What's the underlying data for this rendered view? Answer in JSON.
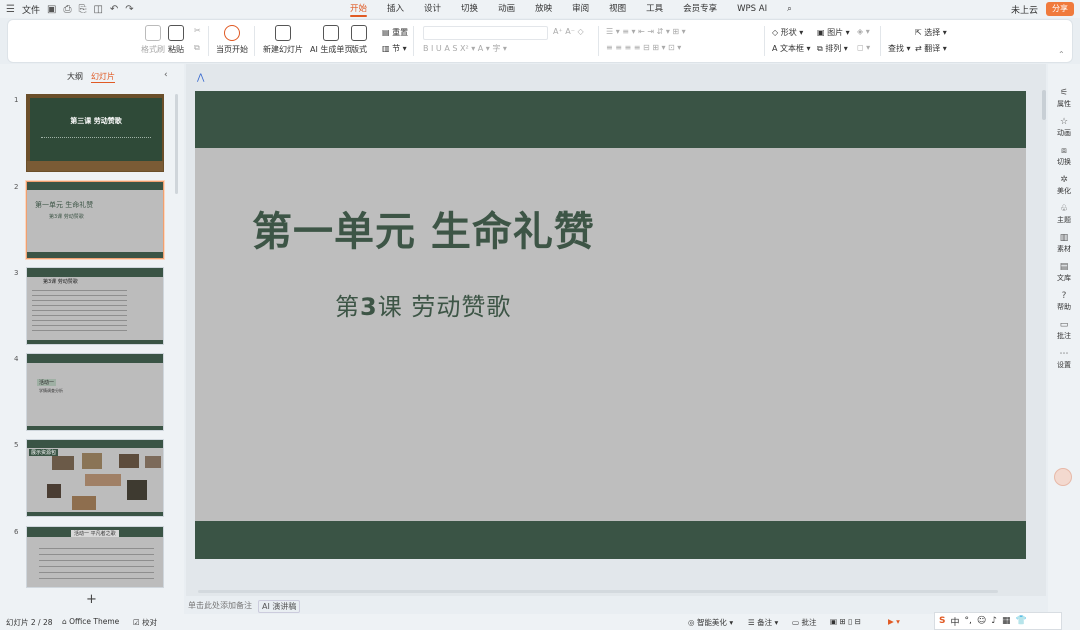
{
  "topbar": {
    "file_label": "文件",
    "menu": [
      "开始",
      "插入",
      "设计",
      "切换",
      "动画",
      "放映",
      "审阅",
      "视图",
      "工具",
      "会员专享",
      "WPS AI"
    ],
    "active_menu": "开始",
    "cloud_label": "未上云",
    "share_label": "分享"
  },
  "ribbon": {
    "format_painter": "格式刷",
    "paste": "粘贴",
    "play_current": "当页开始",
    "new_slide": "新建幻灯片",
    "ai_generate": "AI 生成单页",
    "layout": "版式",
    "reset": "重置",
    "section": "节",
    "shape": "形状",
    "picture": "图片",
    "textbox": "文本框",
    "arrange": "排列",
    "find": "查找",
    "select": "选择",
    "translate": "翻译"
  },
  "left_panel": {
    "tab_outline": "大纲",
    "tab_slides": "幻灯片",
    "slides": [
      {
        "num": "1",
        "title": "第三课  劳动赞歌"
      },
      {
        "num": "2",
        "title": "第一单元 生命礼赞",
        "sub": "第3课  劳动赞歌"
      },
      {
        "num": "3",
        "title": "第3课    劳动赞歌"
      },
      {
        "num": "4",
        "title": "活动一",
        "sub": "学情调查分析"
      },
      {
        "num": "5",
        "title": "展示资源包"
      },
      {
        "num": "6",
        "title": "活动一  平凡者之歌"
      }
    ]
  },
  "slide": {
    "title": "第一单元  生命礼赞",
    "subtitle_prefix": "第",
    "subtitle_num": "3",
    "subtitle_rest": "课    劳动赞歌"
  },
  "right_bar": [
    "属性",
    "动画",
    "切换",
    "美化",
    "主题",
    "素材",
    "文库",
    "帮助",
    "批注",
    "设置"
  ],
  "notes": {
    "placeholder": "单击此处添加备注",
    "ai_label": "AI 演讲稿"
  },
  "statusbar": {
    "slide_counter": "幻灯片 2 / 28",
    "theme": "Office Theme",
    "proofread": "校对",
    "smart_beautify": "智能美化",
    "notes": "备注",
    "comments": "批注"
  },
  "ime": {
    "lang": "中"
  }
}
